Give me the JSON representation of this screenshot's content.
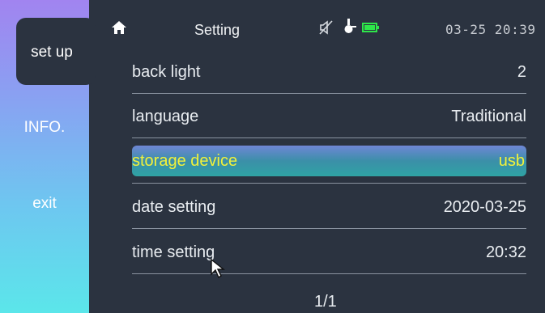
{
  "header": {
    "title": "Setting",
    "clock": "03-25 20:39",
    "icons": [
      "home-icon",
      "mute-icon",
      "probe-icon",
      "battery-icon"
    ]
  },
  "sidebar": {
    "items": [
      {
        "label": "set up",
        "active": true
      },
      {
        "label": "INFO."
      },
      {
        "label": "exit"
      }
    ]
  },
  "settings": {
    "rows": [
      {
        "label": "back light",
        "value": "2"
      },
      {
        "label": "language",
        "value": "Traditional"
      },
      {
        "label": "storage device",
        "value": "usb",
        "selected": true
      },
      {
        "label": "date setting",
        "value": "2020-03-25"
      },
      {
        "label": "time setting",
        "value": "20:32"
      }
    ]
  },
  "pager": {
    "text": "1/1"
  },
  "colors": {
    "background": "#2b3340",
    "selected_text": "#f2f23a",
    "battery": "#2ee64a"
  }
}
